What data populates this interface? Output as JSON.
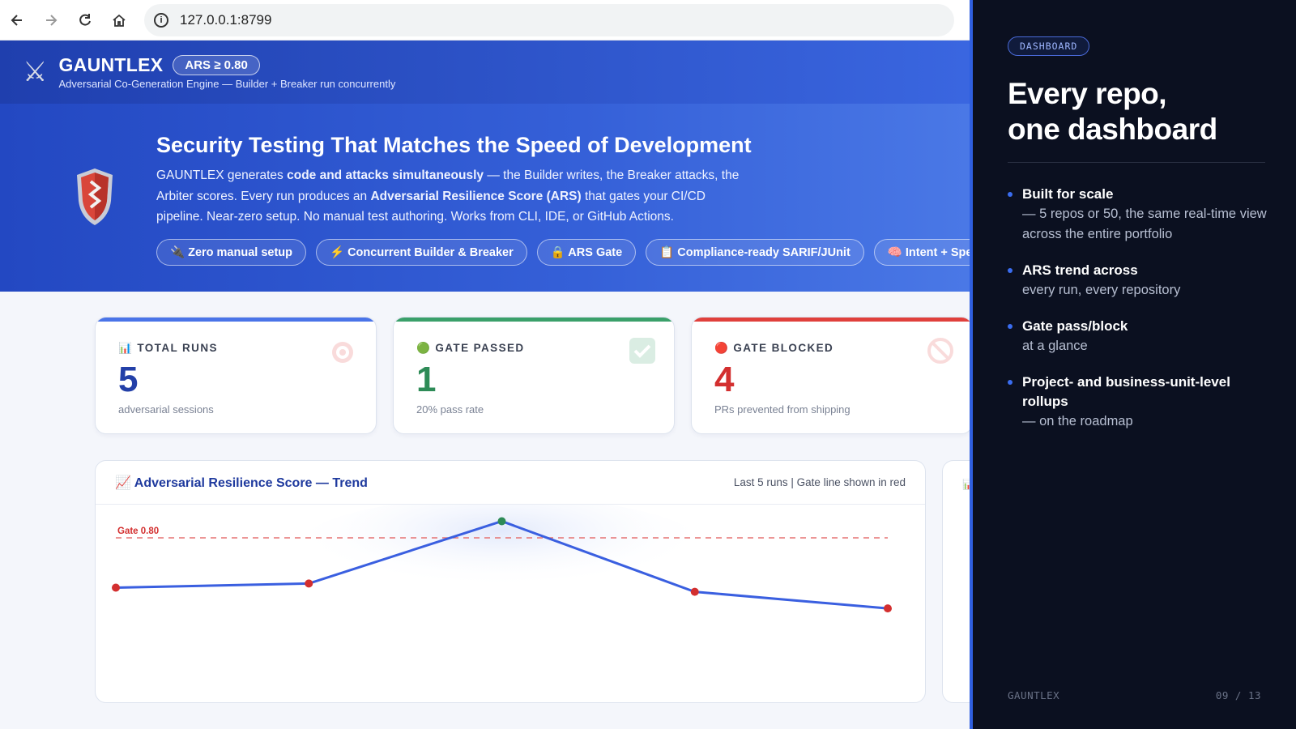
{
  "browser": {
    "url": "127.0.0.1:8799",
    "icons": [
      "back-arrow-icon",
      "forward-arrow-icon",
      "reload-icon",
      "home-icon",
      "info-icon"
    ]
  },
  "app": {
    "brand": "GAUNTLEX",
    "badge": "ARS ≥ 0.80",
    "subtitle": "Adversarial Co-Generation Engine — Builder + Breaker run concurrently"
  },
  "hero": {
    "title": "Security Testing That Matches the Speed of Development",
    "p1": "GAUNTLEX generates ",
    "p1_bold": "code and attacks simultaneously",
    "p2": " — the Builder writes, the Breaker attacks, the Arbiter scores. Every run produces an ",
    "p2_bold": "Adversarial Resilience Score (ARS)",
    "p3": " that gates your CI/CD pipeline. Near-zero setup. No manual test authoring. Works from CLI, IDE, or GitHub Actions.",
    "pills": [
      "🔌 Zero manual setup",
      "⚡ Concurrent Builder & Breaker",
      "🔒 ARS Gate",
      "📋 Compliance-ready SARIF/JUnit",
      "🧠 Intent + Spe"
    ]
  },
  "cards": [
    {
      "icon": "📊",
      "label": "TOTAL RUNS",
      "value": "5",
      "desc": "adversarial sessions",
      "color": "#2340a8",
      "bar": "#4a74e8"
    },
    {
      "icon": "🟢",
      "label": "GATE PASSED",
      "value": "1",
      "desc": "20% pass rate",
      "color": "#2e8b57",
      "bar": "#3aa06a"
    },
    {
      "icon": "🔴",
      "label": "GATE BLOCKED",
      "value": "4",
      "desc": "PRs prevented from shipping",
      "color": "#d32f2f",
      "bar": "#e0403c"
    }
  ],
  "chart": {
    "title": "📈 Adversarial Resilience Score — Trend",
    "meta": "Last 5 runs  |  Gate line shown in red",
    "gate_label": "Gate 0.80"
  },
  "chart_data": {
    "type": "line",
    "x": [
      1,
      2,
      3,
      4,
      5
    ],
    "values": [
      0.74,
      0.745,
      0.82,
      0.735,
      0.715
    ],
    "gate": 0.8,
    "ylim": [
      0.6,
      0.84
    ],
    "pass_color": "#2e8b57",
    "fail_color": "#d32f2f",
    "line_color": "#3a5fe0"
  },
  "slide": {
    "tag": "DASHBOARD",
    "title_line1": "Every repo,",
    "title_line2": "one dashboard",
    "bullets": [
      {
        "b": "Built for scale",
        "s": "— 5 repos or 50, the same real-time view across the entire portfolio"
      },
      {
        "b": "ARS trend across",
        "s": "every run, every repository"
      },
      {
        "b": "Gate pass/block",
        "s": "at a glance"
      },
      {
        "b": "Project- and business-unit-level rollups",
        "s": "— on the roadmap"
      }
    ],
    "footer_left": "GAUNTLEX",
    "footer_right": "09 / 13"
  }
}
